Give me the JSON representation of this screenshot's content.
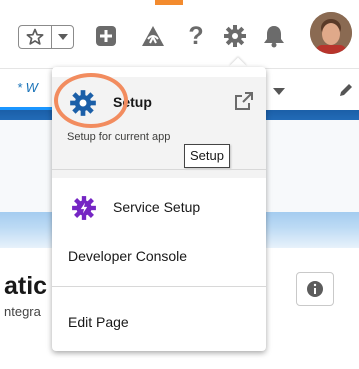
{
  "header": {
    "icons": [
      "star-icon",
      "chevron-down-icon",
      "plus-icon",
      "trailhead-icon",
      "help-icon",
      "gear-icon",
      "bell-icon"
    ],
    "help_glyph": "?"
  },
  "nav": {
    "tab_label": "* W",
    "active_color": "#1b96ff"
  },
  "page": {
    "title_fragment": "atic",
    "subtitle_fragment": "ntegra"
  },
  "setup_menu": {
    "items": [
      {
        "label": "Setup",
        "sublabel": "Setup for current app",
        "icon": "gear-blue-icon",
        "trailing_icon": "external-link-icon"
      },
      {
        "label": "Service Setup",
        "icon": "gear-purple-icon"
      },
      {
        "label": "Developer Console"
      },
      {
        "label": "Edit Page"
      }
    ],
    "tooltip": "Setup"
  },
  "colors": {
    "setup_icon": "#1b5fa8",
    "service_icon": "#7526c4",
    "highlight_ring": "#f28c5f",
    "banner": "#2f7fd0"
  }
}
